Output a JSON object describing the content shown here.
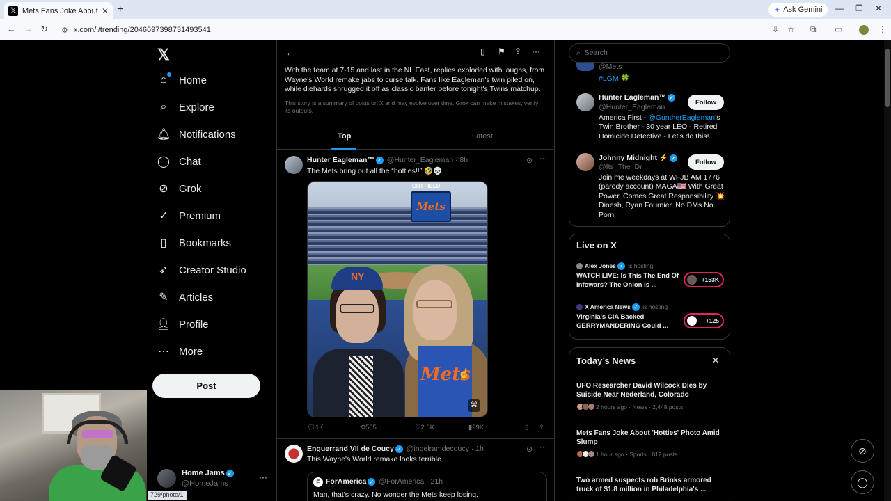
{
  "browser": {
    "tab_title": "Mets Fans Joke About 'Hotties'",
    "tab_close": "✕",
    "new_tab": "+",
    "ask_gemini": "Ask Gemini",
    "url": "x.com/i/trending/2046697398731493541",
    "status_url": "729/photo/1"
  },
  "nav": {
    "logo": "𝕏",
    "items": [
      {
        "label": "Home",
        "icon": "home-icon"
      },
      {
        "label": "Explore",
        "icon": "search-icon"
      },
      {
        "label": "Notifications",
        "icon": "bell-icon"
      },
      {
        "label": "Chat",
        "icon": "chat-icon"
      },
      {
        "label": "Grok",
        "icon": "grok-icon"
      },
      {
        "label": "Premium",
        "icon": "premium-icon"
      },
      {
        "label": "Bookmarks",
        "icon": "bookmark-icon"
      },
      {
        "label": "Creator Studio",
        "icon": "rocket-icon"
      },
      {
        "label": "Articles",
        "icon": "article-icon"
      },
      {
        "label": "Profile",
        "icon": "person-icon"
      },
      {
        "label": "More",
        "icon": "more-icon"
      }
    ],
    "post_label": "Post",
    "account": {
      "name": "Home Jams",
      "handle": "@HomeJams"
    }
  },
  "main": {
    "summary": "With the team at 7-15 and last in the NL East, replies exploded with laughs, from Wayne's World remake jabs to curse talk. Fans like Eagleman's twin piled on, while diehards shrugged it off as classic banter before tonight's Twins matchup.",
    "disclaimer": "This story is a summary of posts on X and may evolve over time. Grok can make mistakes, verify its outputs.",
    "tabs": {
      "top": "Top",
      "latest": "Latest"
    },
    "tweet1": {
      "name": "Hunter Eagleman™",
      "handle": "@Hunter_Eagleman · 8h",
      "text": "The Mets bring out all the “hotties!!” 🤣💀",
      "photo_scoreboard": "Mets",
      "photo_citi": "CITI FIELD",
      "photo_cap": "NY",
      "photo_shirt": "Mets",
      "replies": "1K",
      "reposts": "565",
      "likes": "2.6K",
      "views": "99K"
    },
    "tweet2": {
      "name": "Enguerrand VII de Coucy",
      "handle": "@ingelramdecoucy · 1h",
      "text": "This Wayne's World remake looks terrible",
      "quote": {
        "avatar_letter": "F",
        "name": "ForAmerica",
        "handle": "@ForAmerica · 21h",
        "text": "Man, that's crazy. No wonder the Mets keep losing."
      }
    }
  },
  "sidebar": {
    "search_placeholder": "Search",
    "top_partial": {
      "handle": "@Mets",
      "tag": "#LGM 🍀"
    },
    "who_to_follow": [
      {
        "name": "Hunter Eagleman™",
        "handle": "@Hunter_Eagleman",
        "bio_pre": "America First - ",
        "bio_mention": "@GuntherEagleman",
        "bio_post": "’s Twin Brother - 30 year LEO - Retired Homicide Detective - Let’s do this!",
        "button": "Follow"
      },
      {
        "name": "Johnny Midnight ⚡",
        "handle": "@Its_The_Dr",
        "bio_pre": "Join me weekdays at WFJB AM 1776 (parody account) MAGA🇺🇸 With Great Power, Comes Great Responsibility 💥 Dinesh, Ryan Fournier. No DMs No Porn.",
        "bio_mention": "",
        "bio_post": "",
        "button": "Follow"
      }
    ],
    "live": {
      "title": "Live on X",
      "items": [
        {
          "host": "Alex Jones",
          "hosting": "is hosting",
          "title": "WATCH LIVE: Is This The End Of Infowars? The Onion Is ...",
          "count": "+153K"
        },
        {
          "host": "X America News",
          "hosting": "is hosting",
          "title": "Virginia's CIA Backed GERRYMANDERING Could ...",
          "count": "+125"
        }
      ]
    },
    "news": {
      "title": "Today’s News",
      "close": "✕",
      "items": [
        {
          "title": "UFO Researcher David Wilcock Dies by Suicide Near Nederland, Colorado",
          "meta": "2 hours ago · News · 2,448 posts"
        },
        {
          "title": "Mets Fans Joke About 'Hotties' Photo Amid Slump",
          "meta": "1 hour ago · Sports · 812 posts"
        },
        {
          "title": "Two armed suspects rob Brinks armored truck of $1.8 million in Philadelphia's ...",
          "meta": ""
        }
      ]
    }
  },
  "colors": {
    "accent": "#1d9bf0",
    "border": "#2f3336",
    "muted": "#71767b",
    "live": "#e0245e"
  }
}
